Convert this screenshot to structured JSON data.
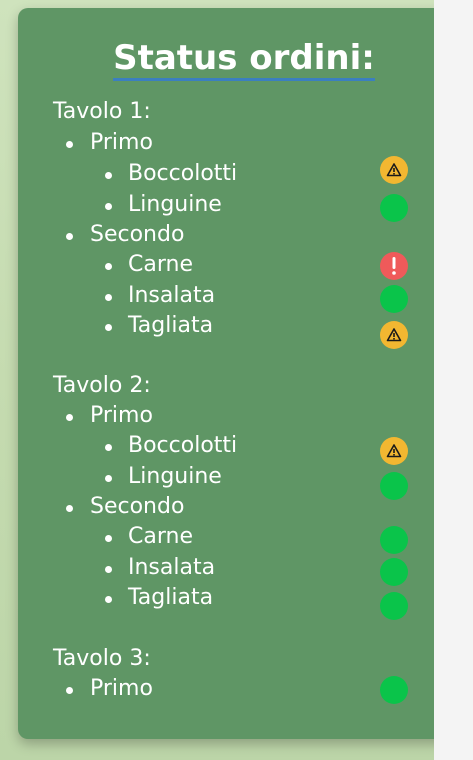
{
  "title": "Status ordini:",
  "tables": [
    {
      "label": "Tavolo 1:",
      "courses": [
        {
          "label": "Primo",
          "status": null,
          "items": [
            {
              "label": "Boccolotti",
              "status": "warning-icon"
            },
            {
              "label": "Linguine",
              "status": "ok-icon"
            }
          ]
        },
        {
          "label": "Secondo",
          "status": null,
          "items": [
            {
              "label": "Carne",
              "status": "alert-icon"
            },
            {
              "label": "Insalata",
              "status": "ok-icon"
            },
            {
              "label": "Tagliata",
              "status": "warning-icon"
            }
          ]
        }
      ]
    },
    {
      "label": "Tavolo 2:",
      "courses": [
        {
          "label": "Primo",
          "status": null,
          "items": [
            {
              "label": "Boccolotti",
              "status": "warning-icon"
            },
            {
              "label": "Linguine",
              "status": "ok-icon"
            }
          ]
        },
        {
          "label": "Secondo",
          "status": null,
          "items": [
            {
              "label": "Carne",
              "status": "ok-icon"
            },
            {
              "label": "Insalata",
              "status": "ok-icon"
            },
            {
              "label": "Tagliata",
              "status": "ok-icon"
            }
          ]
        }
      ]
    },
    {
      "label": "Tavolo 3:",
      "courses": [
        {
          "label": "Primo",
          "status": "ok-icon",
          "items": []
        }
      ]
    }
  ],
  "colors": {
    "panel": "#5f9665",
    "ok": "#0ac44a",
    "warning": "#f2b731",
    "alert": "#ef5a5a",
    "title_underline": "#3b7fc0"
  }
}
